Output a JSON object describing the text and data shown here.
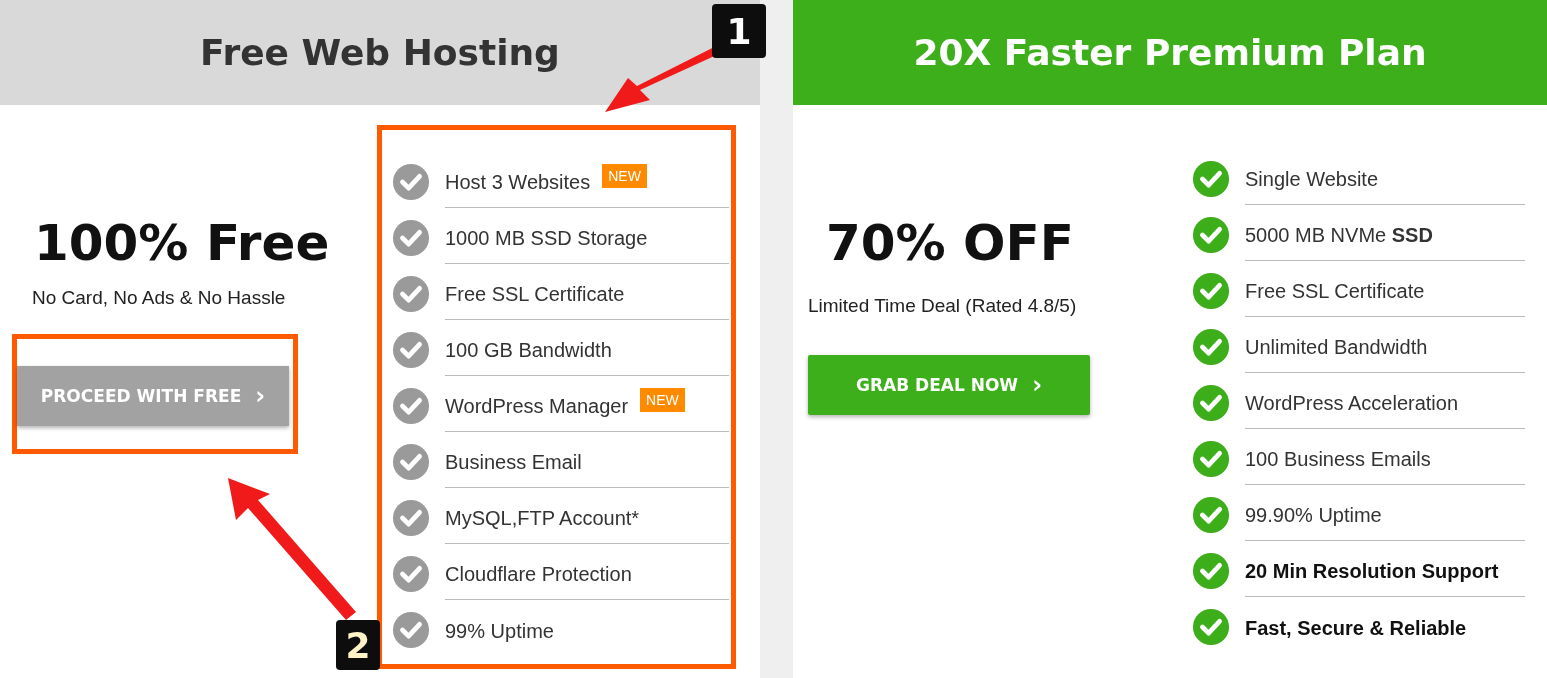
{
  "plans": [
    {
      "kind": "free",
      "title": "Free Web Hosting",
      "headline": "100% Free",
      "subtitle": "No Card, No Ads & No Hassle",
      "button": {
        "label": "PROCEED WITH FREE",
        "icon": "›",
        "highlighted": true
      },
      "features_highlighted": true,
      "features": [
        {
          "text": "Host 3 Websites",
          "badge": "NEW",
          "bold": false
        },
        {
          "text": "1000 MB SSD Storage",
          "bold": false
        },
        {
          "text": "Free SSL Certificate",
          "bold": false
        },
        {
          "text": "100 GB Bandwidth",
          "bold": false
        },
        {
          "text": "WordPress Manager",
          "badge": "NEW",
          "bold": false
        },
        {
          "text": "Business Email",
          "bold": false
        },
        {
          "text": "MySQL,FTP Account*",
          "bold": false
        },
        {
          "text": "Cloudflare Protection",
          "bold": false
        },
        {
          "text": "99% Uptime",
          "bold": false
        }
      ]
    },
    {
      "kind": "premium",
      "title": "20X Faster Premium Plan",
      "headline": "70% OFF",
      "subtitle": "Limited Time Deal (Rated 4.8/5)",
      "button": {
        "label": "GRAB DEAL NOW",
        "icon": "›",
        "highlighted": false
      },
      "features_highlighted": false,
      "features": [
        {
          "text": "Single Website",
          "bold": false
        },
        {
          "text": "5000 MB NVMe **SSD**",
          "bold": false
        },
        {
          "text": "Free SSL Certificate",
          "bold": false
        },
        {
          "text": "Unlimited Bandwidth",
          "bold": false
        },
        {
          "text": "WordPress Acceleration",
          "bold": false
        },
        {
          "text": "100 Business Emails",
          "bold": false
        },
        {
          "text": "99.90% Uptime",
          "bold": false
        },
        {
          "text": "20 Min Resolution Support",
          "bold": true
        },
        {
          "text": "Fast, Secure & Reliable",
          "bold": true
        }
      ]
    }
  ],
  "annotations": [
    {
      "label": "1"
    },
    {
      "label": "2"
    }
  ]
}
